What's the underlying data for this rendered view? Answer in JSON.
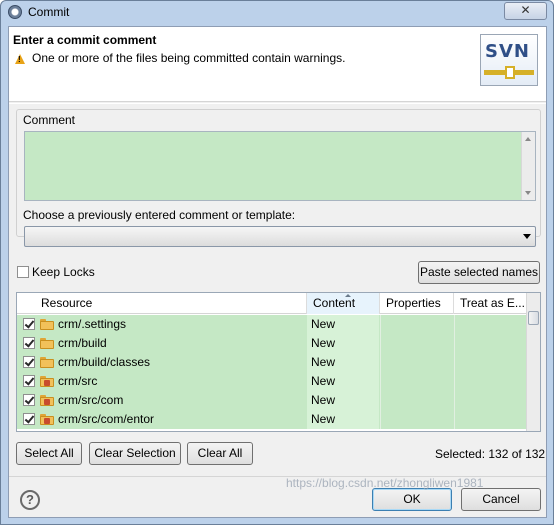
{
  "window": {
    "title": "Commit",
    "close_label": "✕"
  },
  "header": {
    "title": "Enter a commit comment",
    "warning": "One or more of the files being committed contain warnings.",
    "logo_text": "SVN"
  },
  "comment": {
    "label": "Comment",
    "value": ""
  },
  "template": {
    "label": "Choose a previously entered comment or template:",
    "selected": ""
  },
  "keep_locks": {
    "label": "Keep Locks",
    "checked": false
  },
  "paste_button": "Paste selected names",
  "table": {
    "columns": [
      "Resource",
      "Content",
      "Properties",
      "Treat as E..."
    ],
    "sorted_column": "Content",
    "rows": [
      {
        "resource": "crm/.settings",
        "content": "New",
        "properties": "",
        "treat": "",
        "checked": true,
        "icon": "folder-icon"
      },
      {
        "resource": "crm/build",
        "content": "New",
        "properties": "",
        "treat": "",
        "checked": true,
        "icon": "folder-icon"
      },
      {
        "resource": "crm/build/classes",
        "content": "New",
        "properties": "",
        "treat": "",
        "checked": true,
        "icon": "folder-icon"
      },
      {
        "resource": "crm/src",
        "content": "New",
        "properties": "",
        "treat": "",
        "checked": true,
        "icon": "package-folder-icon"
      },
      {
        "resource": "crm/src/com",
        "content": "New",
        "properties": "",
        "treat": "",
        "checked": true,
        "icon": "package-folder-icon"
      },
      {
        "resource": "crm/src/com/entor",
        "content": "New",
        "properties": "",
        "treat": "",
        "checked": true,
        "icon": "package-folder-icon"
      }
    ]
  },
  "selection": {
    "select_all": "Select All",
    "clear_selection": "Clear Selection",
    "clear_all": "Clear All",
    "status": "Selected: 132 of 132"
  },
  "footer": {
    "help": "?",
    "ok": "OK",
    "cancel": "Cancel",
    "watermark": "https://blog.csdn.net/zhongliwen1981"
  },
  "colors": {
    "row_bg": "#c5e8c5",
    "content_col_bg": "#d7f2d7",
    "warning": "#e8a317",
    "logo_text": "#2f4f87"
  }
}
